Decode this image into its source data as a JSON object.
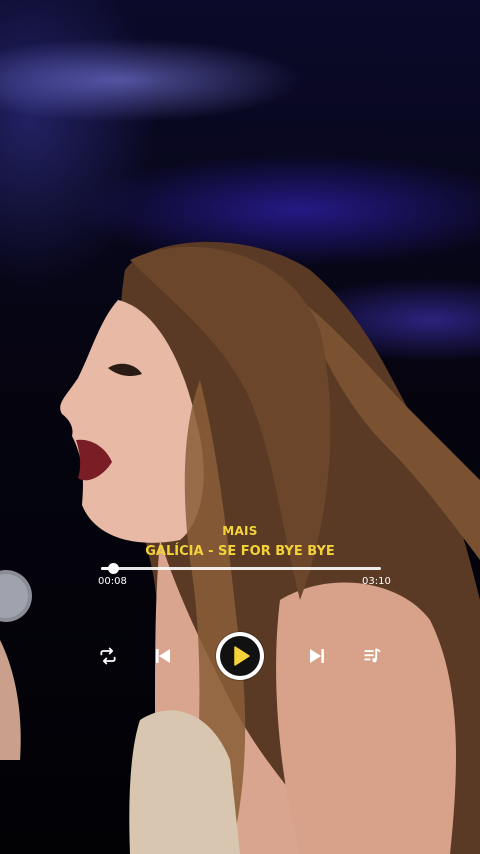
{
  "player": {
    "artist": "MAIS",
    "track_title": "GALÍCIA - SE FOR BYE BYE",
    "elapsed": "00:08",
    "duration": "03:10",
    "progress_fraction": 0.042,
    "accent_color": "#f3d23a"
  },
  "controls": [
    {
      "name": "repeat-button",
      "icon": "repeat-icon"
    },
    {
      "name": "previous-button",
      "icon": "skip-previous-icon"
    },
    {
      "name": "play-button",
      "icon": "play-icon"
    },
    {
      "name": "next-button",
      "icon": "skip-next-icon"
    },
    {
      "name": "playlist-button",
      "icon": "queue-music-icon"
    }
  ]
}
